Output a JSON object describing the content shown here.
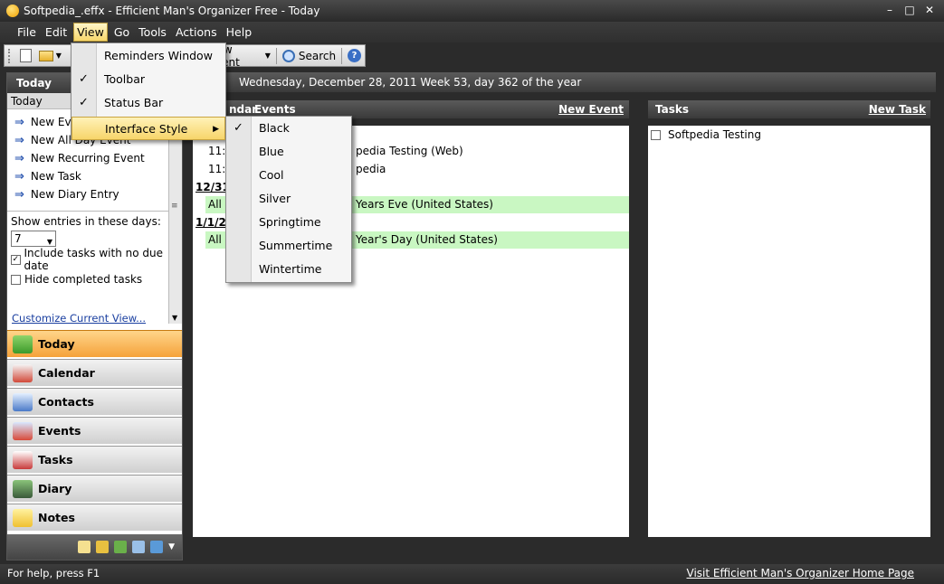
{
  "window": {
    "title": "Softpedia_.effx - Efficient Man's Organizer Free - Today"
  },
  "menu": [
    "File",
    "Edit",
    "View",
    "Go",
    "Tools",
    "Actions",
    "Help"
  ],
  "toolbar": {
    "new_event": "New Event",
    "search": "Search"
  },
  "view_menu": {
    "items": [
      {
        "label": "Reminders Window",
        "checked": false
      },
      {
        "label": "Toolbar",
        "checked": true
      },
      {
        "label": "Status Bar",
        "checked": true
      },
      {
        "label": "Interface Style",
        "checked": false
      }
    ]
  },
  "style_menu": {
    "items": [
      {
        "label": "Black",
        "checked": true
      },
      {
        "label": "Blue",
        "checked": false
      },
      {
        "label": "Cool",
        "checked": false
      },
      {
        "label": "Silver",
        "checked": false
      },
      {
        "label": "Springtime",
        "checked": false
      },
      {
        "label": "Summertime",
        "checked": false
      },
      {
        "label": "Wintertime",
        "checked": false
      }
    ]
  },
  "left": {
    "header": "Today",
    "sub": "Today",
    "actions": [
      "New Event",
      "New All Day Event",
      "New Recurring Event",
      "New Task",
      "New Diary Entry"
    ],
    "show_label": "Show entries in these days:",
    "days": "7",
    "include_tasks": "Include tasks with no due date",
    "hide_completed": "Hide completed tasks",
    "customize": "Customize Current View..."
  },
  "nav": [
    "Today",
    "Calendar",
    "Contacts",
    "Events",
    "Tasks",
    "Diary",
    "Notes"
  ],
  "date_bar": "Wednesday, December 28, 2011   Week 53, day 362 of the year",
  "calendar": {
    "header_left": "ndar",
    "header_events": "Events",
    "new_event": "New Event",
    "rows": [
      {
        "type": "event",
        "time": "11:0",
        "text": "pedia Testing (Web)"
      },
      {
        "type": "event",
        "time": "11:0",
        "text": "pedia"
      },
      {
        "type": "date",
        "text": "12/31"
      },
      {
        "type": "allday",
        "time": "All",
        "text": "Years Eve (United States)"
      },
      {
        "type": "date",
        "text": "1/1/20"
      },
      {
        "type": "allday",
        "time": "All",
        "text": "Year's Day (United States)"
      }
    ]
  },
  "tasks": {
    "header": "Tasks",
    "new_task": "New Task",
    "items": [
      "Softpedia Testing"
    ]
  },
  "status": {
    "help": "For help, press F1",
    "link": "Visit Efficient Man's Organizer Home Page"
  }
}
